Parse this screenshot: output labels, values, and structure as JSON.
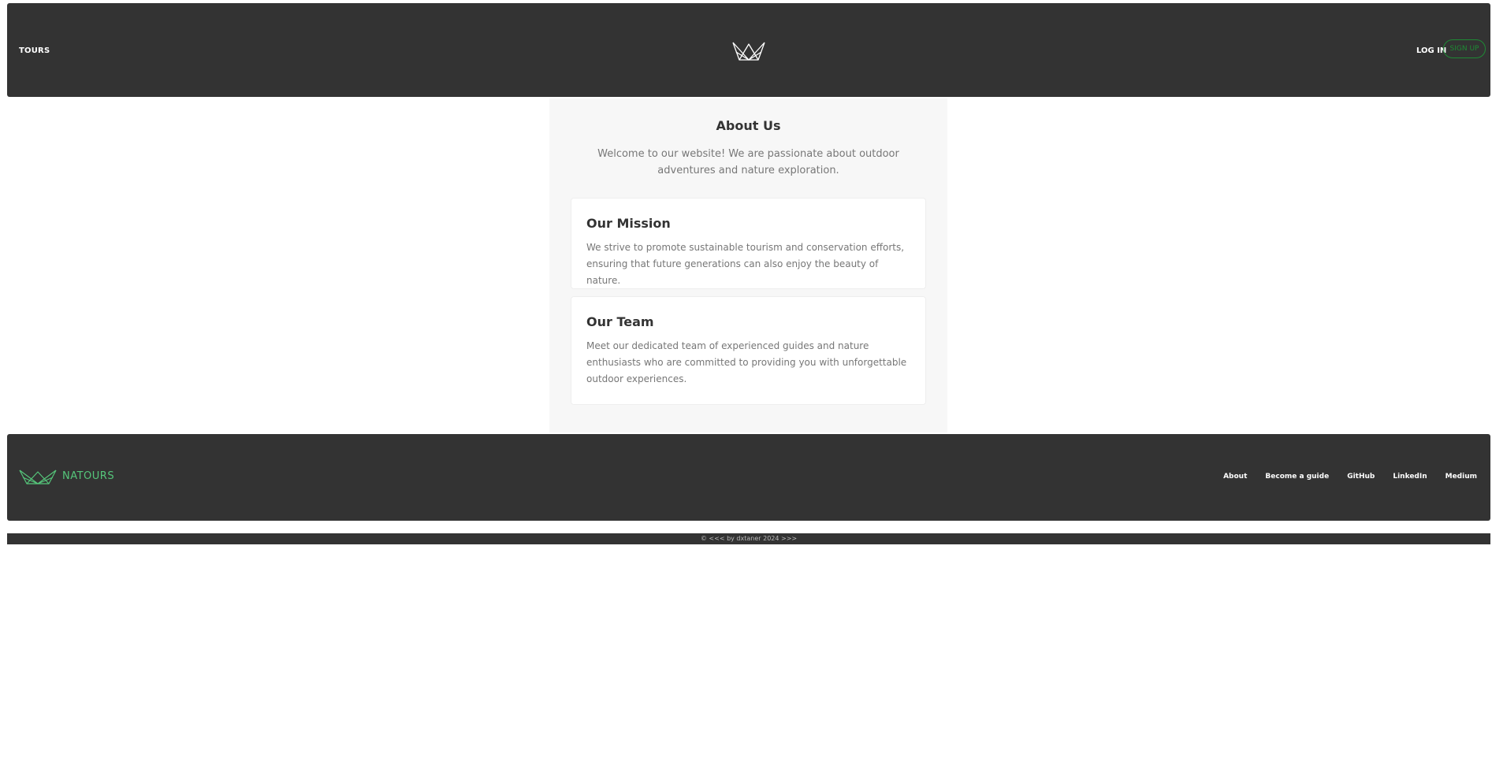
{
  "header": {
    "nav_tours": "TOURS",
    "logo_icon": "crown-icon",
    "login_label": "LOG IN",
    "signup_label": "SIGN UP"
  },
  "main": {
    "title": "About Us",
    "intro": "Welcome to our website! We are passionate about outdoor adventures and nature exploration.",
    "sections": [
      {
        "title": "Our Mission",
        "text": "We strive to promote sustainable tourism and conservation efforts, ensuring that future generations can also enjoy the beauty of nature."
      },
      {
        "title": "Our Team",
        "text": "Meet our dedicated team of experienced guides and nature enthusiasts who are committed to providing you with unforgettable outdoor experiences."
      }
    ]
  },
  "footer": {
    "logo_icon": "crown-icon",
    "brand": "NATOURS",
    "links": [
      "About",
      "Become a guide",
      "GitHub",
      "LinkedIn",
      "Medium"
    ]
  },
  "copyright": "© <<< by dxtaner 2024 >>>",
  "colors": {
    "header_bg": "#333333",
    "accent_green": "#55c57a",
    "signup_green": "#1e8a34"
  }
}
